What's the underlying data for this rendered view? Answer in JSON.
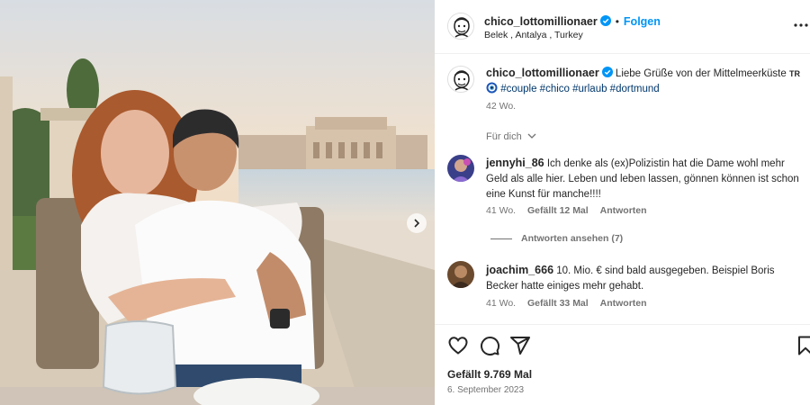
{
  "post": {
    "author": "chico_lottomillionaer",
    "location": "Belek , Antalya , Turkey",
    "follow_label": "Folgen",
    "dot": "•"
  },
  "caption": {
    "author": "chico_lottomillionaer",
    "text": "Liebe Grüße von der Mittelmeerküste",
    "flag": "TR",
    "hashtags": "#couple #chico #urlaub #dortmund",
    "time": "42 Wo."
  },
  "sort_label": "Für dich",
  "comments": [
    {
      "user": "jennyhi_86",
      "text": "Ich denke als (ex)Polizistin hat die Dame wohl mehr Geld als alle hier. Leben und leben lassen, gönnen können ist schon eine Kunst für manche!!!!",
      "time": "41 Wo.",
      "likes": "Gefällt 12 Mal",
      "reply": "Antworten",
      "view_replies": "Antworten ansehen (7)"
    },
    {
      "user": "joachim_666",
      "text": "10. Mio. € sind bald ausgegeben. Beispiel Boris Becker hatte einiges mehr gehabt.",
      "time": "41 Wo.",
      "likes": "Gefällt 33 Mal",
      "reply": "Antworten"
    }
  ],
  "footer": {
    "likes": "Gefällt 9.769 Mal",
    "date": "6. September 2023"
  },
  "colors": {
    "accent": "#0095f6",
    "hashtag": "#00376b",
    "verified": "#0095f6",
    "muted": "#737373"
  },
  "icons": [
    "more-icon",
    "heart-icon",
    "comment-icon",
    "share-icon",
    "bookmark-icon",
    "chevron-down-icon",
    "verified-icon",
    "carousel-next-icon"
  ]
}
